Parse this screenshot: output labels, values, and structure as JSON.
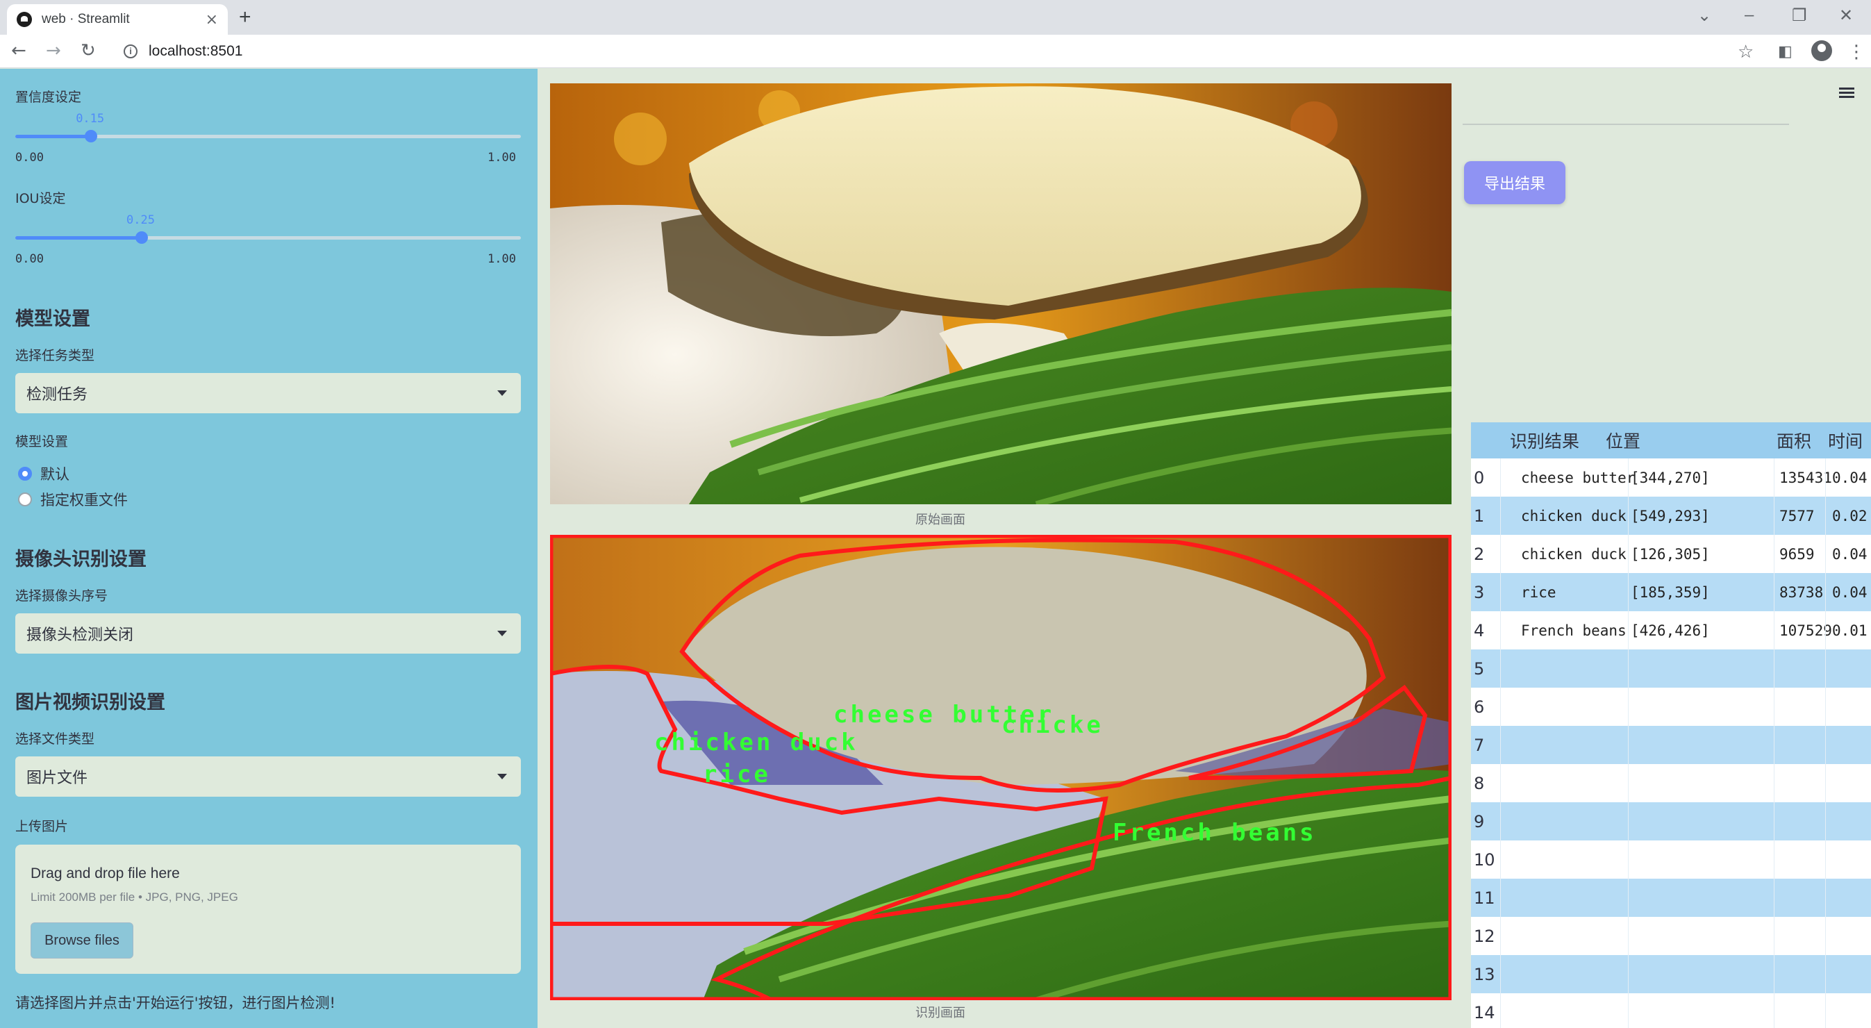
{
  "browser": {
    "tab_title": "web · Streamlit",
    "tab_close": "×",
    "new_tab": "+",
    "url": "localhost:8501",
    "icons": [
      "back-icon",
      "forward-icon",
      "reload-icon",
      "info-icon",
      "star-icon",
      "sidepanel-icon",
      "profile-icon",
      "kebab-icon"
    ]
  },
  "sidebar": {
    "confidence": {
      "label": "置信度设定",
      "value": 0.15,
      "value_text": "0.15",
      "min": "0.00",
      "max": "1.00"
    },
    "iou": {
      "label": "IOU设定",
      "value": 0.25,
      "value_text": "0.25",
      "min": "0.00",
      "max": "1.00"
    },
    "model_header": "模型设置",
    "task_label": "选择任务类型",
    "task_value": "检测任务",
    "model_label": "模型设置",
    "model_options": [
      "默认",
      "指定权重文件"
    ],
    "model_selected": 0,
    "camera_header": "摄像头识别设置",
    "camera_label": "选择摄像头序号",
    "camera_value": "摄像头检测关闭",
    "media_header": "图片视频识别设置",
    "filetype_label": "选择文件类型",
    "filetype_value": "图片文件",
    "upload_label": "上传图片",
    "upload_title": "Drag and drop file here",
    "upload_limit": "Limit 200MB per file • JPG, PNG, JPEG",
    "browse_label": "Browse files",
    "footer_hint": "请选择图片并点击'开始运行'按钮，进行图片检测!"
  },
  "main": {
    "original_caption": "原始画面",
    "result_caption": "识别画面",
    "detection_labels": [
      {
        "text": "cheese butter"
      },
      {
        "text": "chicken duck"
      },
      {
        "text": "chicke"
      },
      {
        "text": "rice"
      },
      {
        "text": "French beans"
      }
    ],
    "colors": {
      "box": "#ff1a1a",
      "label": "#33ff33"
    }
  },
  "right": {
    "export_label": "导出结果",
    "table": {
      "headers": [
        "",
        "识别结果",
        "位置",
        "面积",
        "时间"
      ],
      "rows": [
        {
          "idx": "0",
          "result": "cheese butter",
          "pos": "[344,270]",
          "area": "135431",
          "time": "0.04"
        },
        {
          "idx": "1",
          "result": "chicken duck",
          "pos": "[549,293]",
          "area": "7577",
          "time": "0.02"
        },
        {
          "idx": "2",
          "result": "chicken duck",
          "pos": "[126,305]",
          "area": "9659",
          "time": "0.04"
        },
        {
          "idx": "3",
          "result": "rice",
          "pos": "[185,359]",
          "area": "83738",
          "time": "0.04"
        },
        {
          "idx": "4",
          "result": "French beans",
          "pos": "[426,426]",
          "area": "107529",
          "time": "0.01"
        },
        {
          "idx": "5",
          "result": "",
          "pos": "",
          "area": "",
          "time": ""
        },
        {
          "idx": "6",
          "result": "",
          "pos": "",
          "area": "",
          "time": ""
        },
        {
          "idx": "7",
          "result": "",
          "pos": "",
          "area": "",
          "time": ""
        },
        {
          "idx": "8",
          "result": "",
          "pos": "",
          "area": "",
          "time": ""
        },
        {
          "idx": "9",
          "result": "",
          "pos": "",
          "area": "",
          "time": ""
        },
        {
          "idx": "10",
          "result": "",
          "pos": "",
          "area": "",
          "time": ""
        },
        {
          "idx": "11",
          "result": "",
          "pos": "",
          "area": "",
          "time": ""
        },
        {
          "idx": "12",
          "result": "",
          "pos": "",
          "area": "",
          "time": ""
        },
        {
          "idx": "13",
          "result": "",
          "pos": "",
          "area": "",
          "time": ""
        },
        {
          "idx": "14",
          "result": "",
          "pos": "",
          "area": "",
          "time": ""
        }
      ]
    }
  }
}
